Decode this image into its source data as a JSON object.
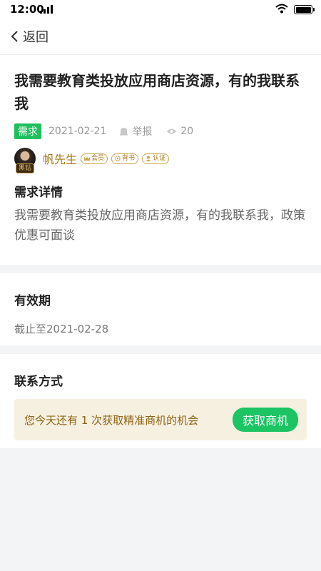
{
  "status_bar": {
    "time": "12:00"
  },
  "nav": {
    "back_label": "返回"
  },
  "post": {
    "title": "我需要教育类投放应用商店资源，有的我联系我",
    "tag": "需求",
    "date": "2021-02-21",
    "report_label": "举报",
    "views": "20"
  },
  "author": {
    "name": "帆先生",
    "avatar_badge": "黑钻",
    "badges": [
      {
        "label": "会员",
        "icon": "crown-icon"
      },
      {
        "label": "背书",
        "icon": "endorse-icon"
      },
      {
        "label": "认证",
        "icon": "user-verified-icon"
      }
    ]
  },
  "detail": {
    "title": "需求详情",
    "body": "我需要教育类投放应用商店资源，有的我联系我，政策优惠可面谈"
  },
  "validity": {
    "title": "有效期",
    "value": "截止至2021-02-28"
  },
  "contact": {
    "title": "联系方式",
    "notice": "您今天还有 1 次获取精准商机的机会",
    "button": "获取商机"
  },
  "colors": {
    "accent_green": "#1cc463",
    "gold": "#a57614",
    "notice_bg": "#f6f0e1"
  }
}
